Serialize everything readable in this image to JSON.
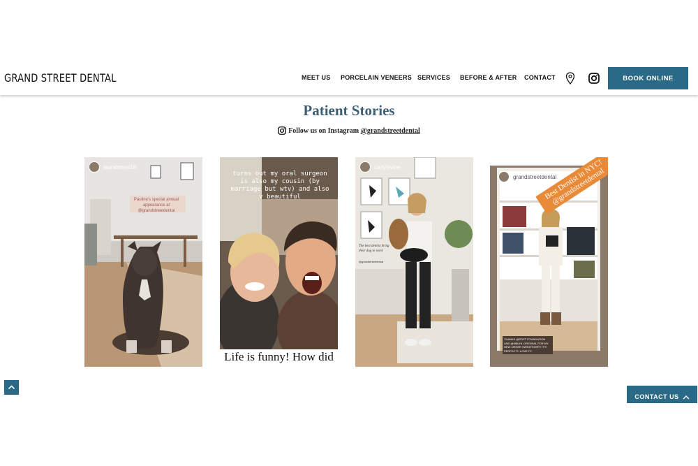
{
  "header": {
    "logo": "GRAND STREET DENTAL",
    "menu": [
      "MEET US",
      "PORCELAIN VENEERS",
      "SERVICES",
      "BEFORE & AFTER",
      "CONTACT"
    ],
    "book_label": "BOOK ONLINE"
  },
  "main": {
    "title": "Patient Stories",
    "follow_prefix": "Follow us on Instagram ",
    "follow_handle": "@grandstreetdental"
  },
  "stories": [
    {
      "handle": "lauratorres18",
      "caption": "Pauline's special annual appearance at @grandstreetdental"
    },
    {
      "top_text": "turns out my oral surgeon is also my cousin (by marriage but wtv) and also v beautiful",
      "bottom_text": "Life is funny! How did"
    },
    {
      "handle": "carlylevine",
      "side_note": "The best dentist bring their dog to work",
      "side_tag": "@grandstreetdental"
    },
    {
      "handle": "grandstreetdental",
      "banner": "Best Dentist in NYC! @grandstreetdental",
      "caption": "THANKS @SDXT FOUNDATION AND @NBUHL ORIGINAL FOR MY NEW ORDER SWEATSHIRT! IT'S PERFECT! I LOVE IT!"
    }
  ],
  "floating": {
    "contact_label": "CONTACT US"
  },
  "colors": {
    "accent": "#2b6a86",
    "title": "#3d6076"
  },
  "icons": [
    "location-pin-icon",
    "instagram-icon",
    "chevron-up-icon"
  ]
}
